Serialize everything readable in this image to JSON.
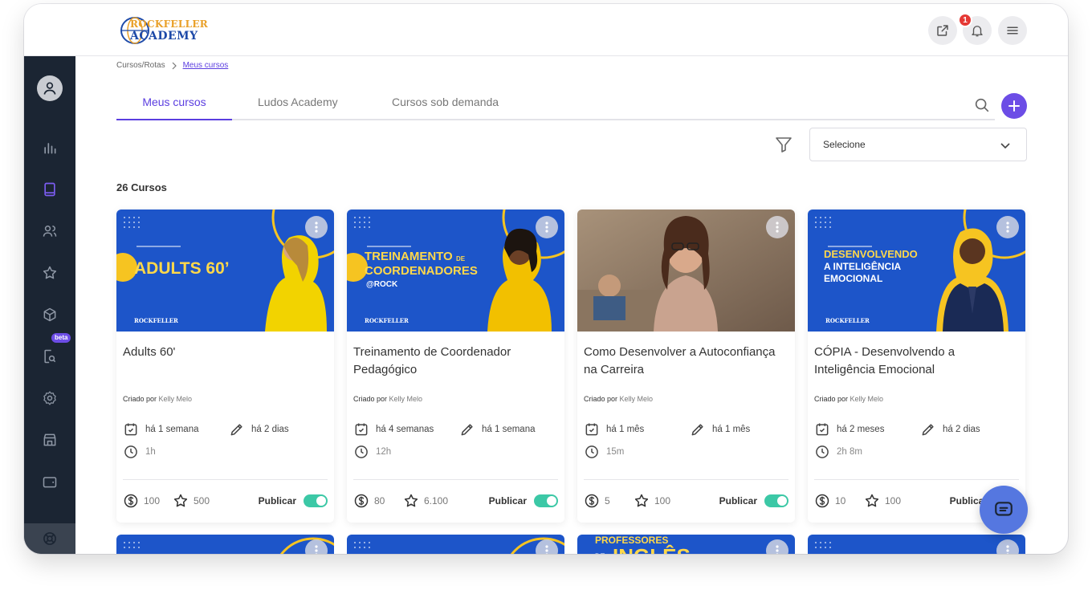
{
  "header": {
    "logo_line1": "ROCKFELLER",
    "logo_line2": "ACADEMY",
    "notification_count": "1"
  },
  "sidebar": {
    "beta_label": "beta",
    "items": [
      "avatar-icon",
      "chart-icon",
      "book-icon",
      "users-icon",
      "star-icon",
      "box-icon",
      "search-doc-icon",
      "gear-icon",
      "store-icon",
      "wallet-icon",
      "support-icon"
    ]
  },
  "breadcrumb": {
    "root": "Cursos/Rotas",
    "current": "Meus cursos"
  },
  "tabs": [
    {
      "label": "Meus cursos",
      "active": true
    },
    {
      "label": "Ludos Academy",
      "active": false
    },
    {
      "label": "Cursos sob demanda",
      "active": false
    }
  ],
  "filter": {
    "select_value": "Selecione"
  },
  "course_count": "26 Cursos",
  "created_prefix": "Criado por",
  "publish_label": "Publicar",
  "courses": [
    {
      "thumb_text": "ADULTS 60’",
      "thumb_brand": "ROCKFELLER",
      "title": "Adults 60'",
      "author": "Kelly Melo",
      "created_ago": "há 1 semana",
      "edited_ago": "há 2 dias",
      "duration": "1h",
      "price": "100",
      "points": "500",
      "published": true
    },
    {
      "thumb_text_1": "TREINAMENTO",
      "thumb_text_de": "DE",
      "thumb_text_2": "COORDENADORES",
      "thumb_text_3": "@ROCK",
      "thumb_brand": "ROCKFELLER",
      "title": "Treinamento de Coordenador Pedagógico",
      "author": "Kelly Melo",
      "created_ago": "há 4 semanas",
      "edited_ago": "há 1 semana",
      "duration": "12h",
      "price": "80",
      "points": "6.100",
      "published": true
    },
    {
      "title": "Como Desenvolver a Autoconfiança na Carreira",
      "author": "Kelly Melo",
      "created_ago": "há 1 mês",
      "edited_ago": "há 1 mês",
      "duration": "15m",
      "price": "5",
      "points": "100",
      "published": true
    },
    {
      "thumb_text_1": "DESENVOLVENDO",
      "thumb_text_2": "A INTELIGÊNCIA",
      "thumb_text_3": "EMOCIONAL",
      "thumb_brand": "ROCKFELLER",
      "title": "CÓPIA - Desenvolvendo a Inteligência Emocional",
      "author": "Kelly Melo",
      "created_ago": "há 2 meses",
      "edited_ago": "há 2 dias",
      "duration": "2h 8m",
      "price": "10",
      "points": "100",
      "published": false
    }
  ],
  "second_row": {
    "thumb3_text_1": "PROFESSORES",
    "thumb3_text_2": "DE",
    "thumb3_text_3": "INGLÊS"
  },
  "colors": {
    "accent": "#5b3ee0",
    "sidebar": "#1b2533",
    "toggle_on": "#3cc8a6",
    "toggle_off": "#e53950",
    "thumb_blue": "#1d55c9"
  }
}
